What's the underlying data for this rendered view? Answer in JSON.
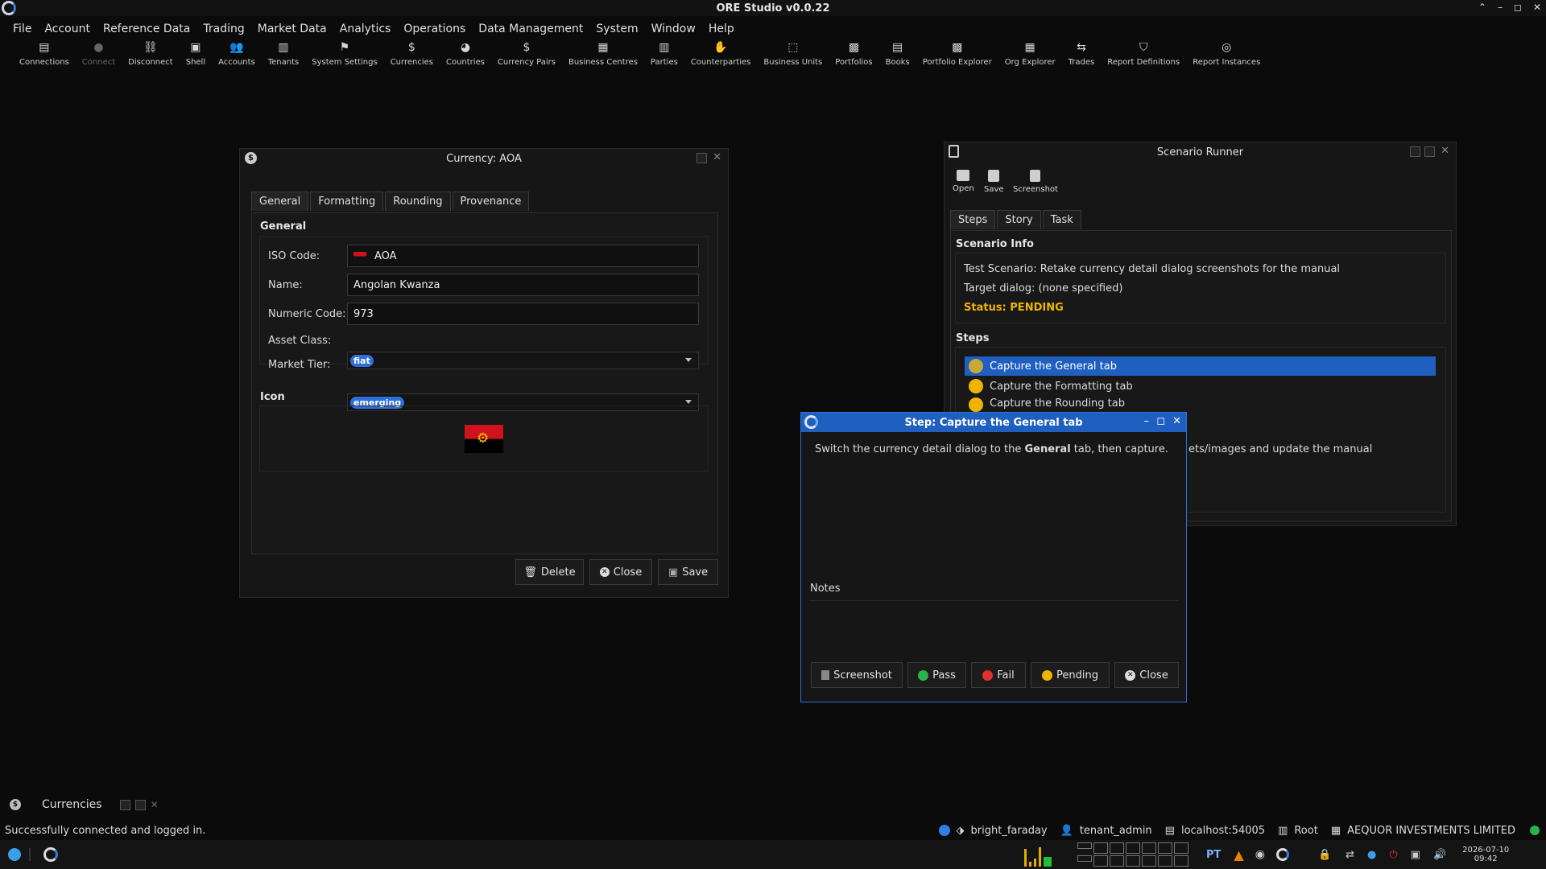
{
  "app": {
    "title": "ORE Studio v0.0.22"
  },
  "menu": [
    "File",
    "Account",
    "Reference Data",
    "Trading",
    "Market Data",
    "Analytics",
    "Operations",
    "Data Management",
    "System",
    "Window",
    "Help"
  ],
  "toolbar": [
    {
      "label": "Connections",
      "icon": "connections-icon",
      "glyph": "▤"
    },
    {
      "label": "Connect",
      "icon": "connect-icon",
      "glyph": "●",
      "disabled": true
    },
    {
      "label": "Disconnect",
      "icon": "disconnect-icon",
      "glyph": "⛓"
    },
    {
      "label": "Shell",
      "icon": "shell-icon",
      "glyph": "▣"
    },
    {
      "label": "Accounts",
      "icon": "accounts-icon",
      "glyph": "👥"
    },
    {
      "label": "Tenants",
      "icon": "tenants-icon",
      "glyph": "▥"
    },
    {
      "label": "System Settings",
      "icon": "flag-icon",
      "glyph": "⚑"
    },
    {
      "label": "Currencies",
      "icon": "currency-icon",
      "glyph": "$"
    },
    {
      "label": "Countries",
      "icon": "globe-icon",
      "glyph": "◕"
    },
    {
      "label": "Currency Pairs",
      "icon": "currency-pairs-icon",
      "glyph": "$"
    },
    {
      "label": "Business Centres",
      "icon": "building-icon",
      "glyph": "▦"
    },
    {
      "label": "Parties",
      "icon": "parties-icon",
      "glyph": "▥"
    },
    {
      "label": "Counterparties",
      "icon": "handshake-icon",
      "glyph": "✋"
    },
    {
      "label": "Business Units",
      "icon": "units-icon",
      "glyph": "⬚"
    },
    {
      "label": "Portfolios",
      "icon": "portfolio-icon",
      "glyph": "▩"
    },
    {
      "label": "Books",
      "icon": "book-icon",
      "glyph": "▤"
    },
    {
      "label": "Portfolio Explorer",
      "icon": "portfolio-explorer-icon",
      "glyph": "▩"
    },
    {
      "label": "Org Explorer",
      "icon": "org-icon",
      "glyph": "▦"
    },
    {
      "label": "Trades",
      "icon": "trades-icon",
      "glyph": "⇆"
    },
    {
      "label": "Report Definitions",
      "icon": "report-def-icon",
      "glyph": "⛉"
    },
    {
      "label": "Report Instances",
      "icon": "report-inst-icon",
      "glyph": "◎"
    }
  ],
  "currency_dialog": {
    "title": "Currency: AOA",
    "tabs": [
      "General",
      "Formatting",
      "Rounding",
      "Provenance"
    ],
    "group_general": "General",
    "iso_label": "ISO Code:",
    "iso_value": "AOA",
    "name_label": "Name:",
    "name_value": "Angolan Kwanza",
    "numeric_label": "Numeric Code:",
    "numeric_value": "973",
    "asset_label": "Asset Class:",
    "asset_value": "fiat",
    "tier_label": "Market Tier:",
    "tier_value": "emerging",
    "group_icon": "Icon",
    "buttons": {
      "delete": "Delete",
      "close": "Close",
      "save": "Save"
    }
  },
  "scenario": {
    "title": "Scenario Runner",
    "toolbar": {
      "open": "Open",
      "save": "Save",
      "screenshot": "Screenshot"
    },
    "tabs": [
      "Steps",
      "Story",
      "Task"
    ],
    "info_label": "Scenario Info",
    "info_line1": "Test Scenario: Retake currency detail dialog screenshots for the manual",
    "info_line2": "Target dialog: (none specified)",
    "status": "Status: PENDING",
    "steps_label": "Steps",
    "steps": [
      "Capture the General tab",
      "Capture the Formatting tab",
      "Capture the Rounding tab"
    ],
    "hidden_text": "ets/images and update the manual"
  },
  "step_dialog": {
    "title": "Step: Capture the General tab",
    "text_before": "Switch the currency detail dialog to the ",
    "text_bold": "General",
    "text_after": " tab, then capture.",
    "notes_label": "Notes",
    "buttons": {
      "screenshot": "Screenshot",
      "pass": "Pass",
      "fail": "Fail",
      "pending": "Pending",
      "close": "Close"
    }
  },
  "mdi_minimized": {
    "label": "Currencies"
  },
  "statusbar": {
    "message": "Successfully connected and logged in.",
    "session": "bright_faraday",
    "user": "tenant_admin",
    "host": "localhost:54005",
    "tenant": "Root",
    "party": "AEQUOR INVESTMENTS LIMITED"
  },
  "taskbar": {
    "lang": "PT",
    "date": "2026-07-10",
    "time": "09:42"
  },
  "colors": {
    "accent": "#2f6fdc",
    "status_pending": "#f0b400",
    "selection": "#1f5fbf",
    "pass": "#29b34a",
    "fail": "#e03030"
  }
}
